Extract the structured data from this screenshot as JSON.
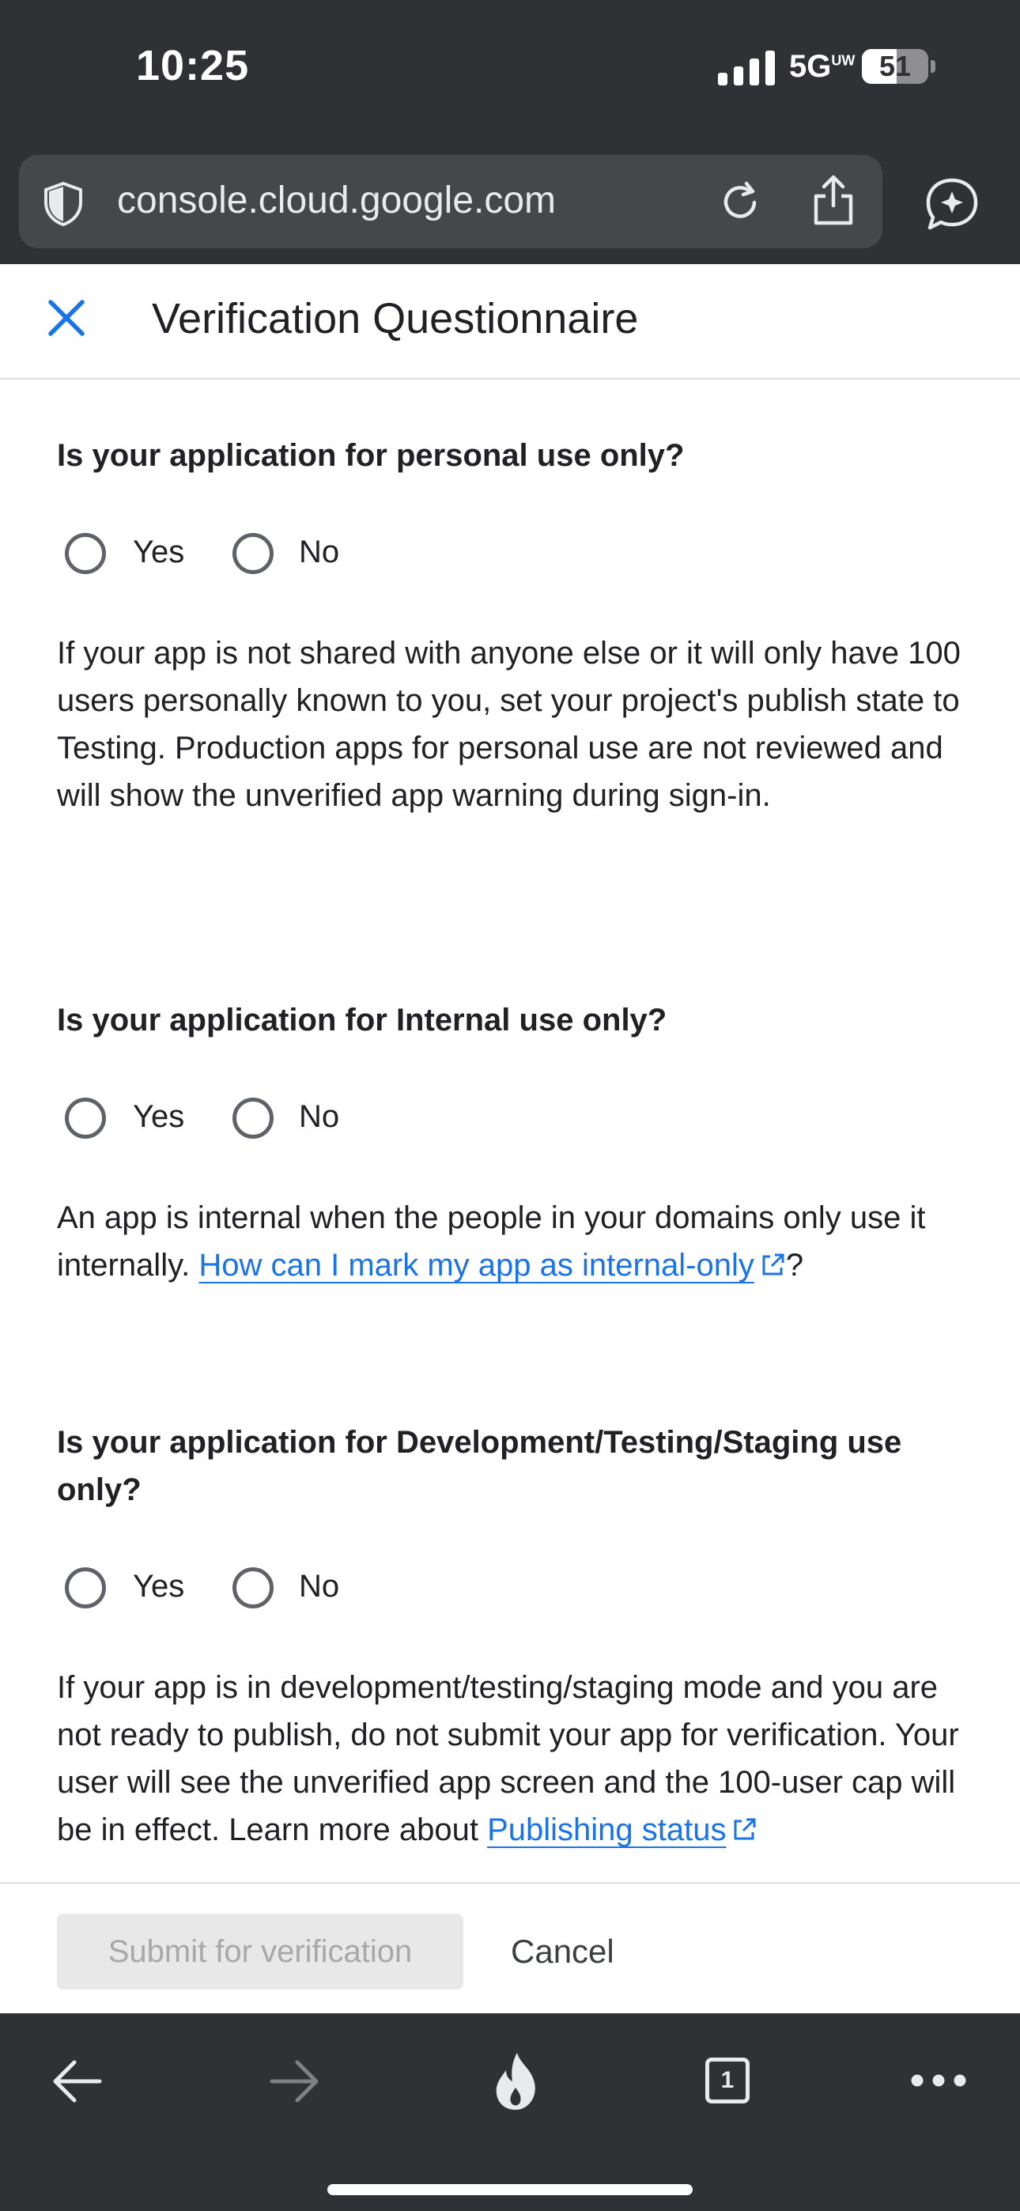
{
  "status_bar": {
    "time": "10:25",
    "network": "5G",
    "network_sup": "UW",
    "battery": "51"
  },
  "browser": {
    "url": "console.cloud.google.com",
    "tab_count": "1"
  },
  "dialog": {
    "title": "Verification Questionnaire"
  },
  "questions": [
    {
      "question": "Is your application for personal use only?",
      "yes_label": "Yes",
      "no_label": "No",
      "description": "If your app is not shared with anyone else or it will only have 100 users personally known to you, set your project's publish state to Testing. Production apps for personal use are not reviewed and will show the unverified app warning during sign-in."
    },
    {
      "question": "Is your application for Internal use only?",
      "yes_label": "Yes",
      "no_label": "No",
      "description_before": "An app is internal when the people in your domains only use it internally.",
      "link_text": "How can I mark my app as internal-only",
      "description_after": "?"
    },
    {
      "question": "Is your application for Development/Testing/Staging use only?",
      "yes_label": "Yes",
      "no_label": "No",
      "description_before": "If your app is in development/testing/staging mode and you are not ready to publish, do not submit your app for verification. Your user will see the unverified app screen and the 100-user cap will be in effect. Learn more about",
      "link_text": "Publishing status"
    }
  ],
  "footer": {
    "submit_label": "Submit for verification",
    "cancel_label": "Cancel"
  },
  "colors": {
    "accent": "#1a73e8",
    "browser_chrome": "#303134",
    "disabled_button": "#e8e8e8"
  }
}
